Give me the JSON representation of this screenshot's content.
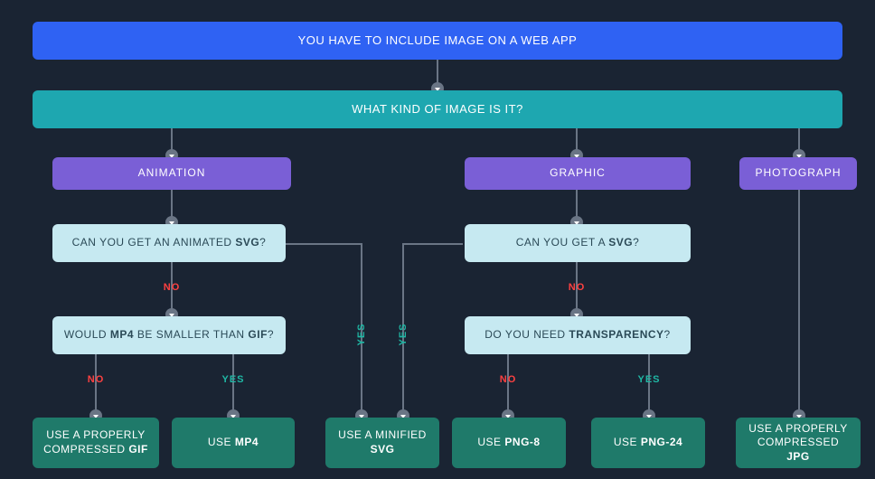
{
  "top": "YOU HAVE TO INCLUDE IMAGE ON A WEB APP",
  "q_kind": "WHAT KIND OF IMAGE IS IT?",
  "cat_animation": "ANIMATION",
  "cat_graphic": "GRAPHIC",
  "cat_photograph": "PHOTOGRAPH",
  "q_anim_svg_pre": "CAN YOU GET AN ANIMATED ",
  "q_anim_svg_bold": "SVG",
  "q_anim_svg_post": "?",
  "q_graphic_svg_pre": "CAN YOU GET A ",
  "q_graphic_svg_bold": "SVG",
  "q_graphic_svg_post": "?",
  "q_mp4_pre": "WOULD ",
  "q_mp4_b1": "MP4",
  "q_mp4_mid": " BE SMALLER THAN ",
  "q_mp4_b2": "GIF",
  "q_mp4_post": "?",
  "q_trans_pre": "DO YOU NEED ",
  "q_trans_bold": "TRANSPARENCY",
  "q_trans_post": "?",
  "out_gif_pre": "USE A PROPERLY COMPRESSED ",
  "out_gif_bold": "GIF",
  "out_mp4_pre": "USE ",
  "out_mp4_bold": "MP4",
  "out_svg_pre": "USE A MINIFIED ",
  "out_svg_bold": "SVG",
  "out_png8_pre": "USE ",
  "out_png8_bold": "PNG-8",
  "out_png24_pre": "USE ",
  "out_png24_bold": "PNG-24",
  "out_jpg_pre": "USE A PROPERLY COMPRESSED ",
  "out_jpg_bold": "JPG",
  "label_no": "NO",
  "label_yes": "YES"
}
